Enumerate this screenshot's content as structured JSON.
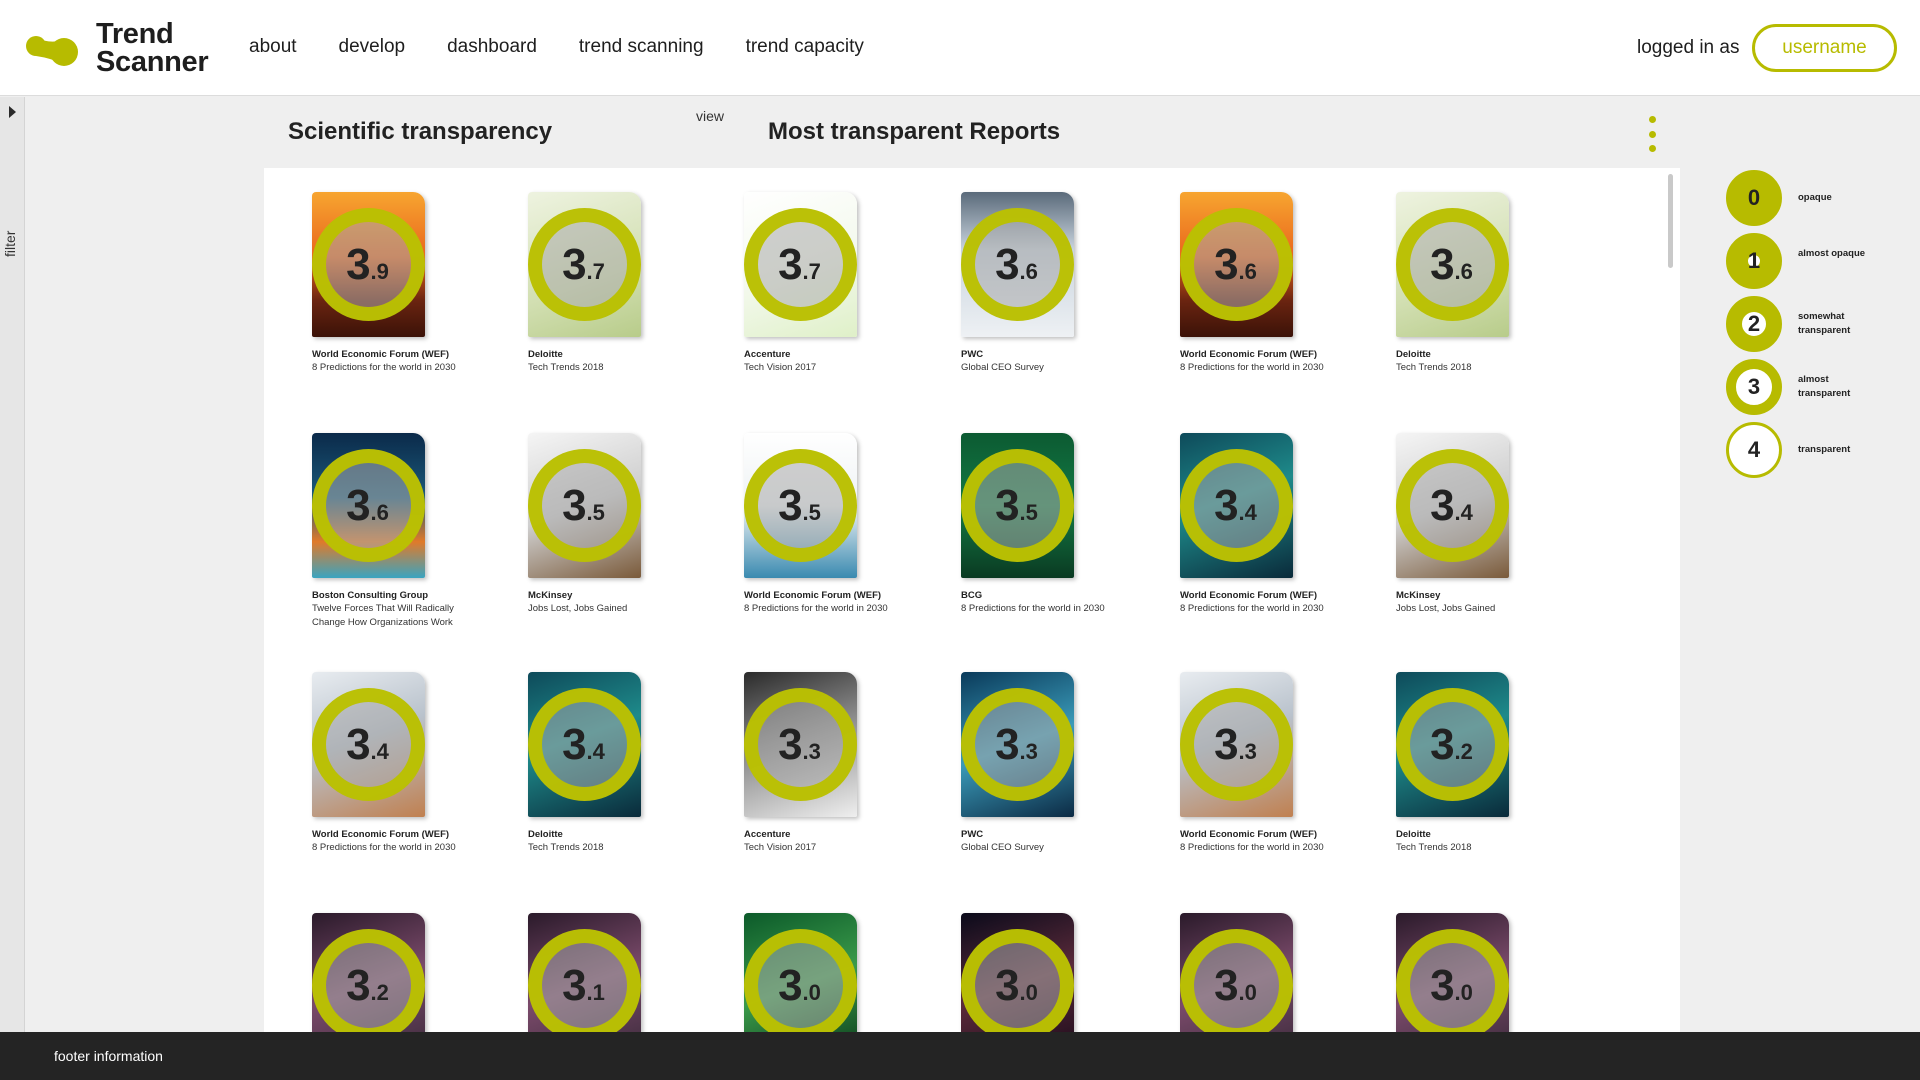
{
  "app": {
    "logo_line1": "Trend",
    "logo_line2": "Scanner",
    "accent_color": "#b7bb00"
  },
  "nav": {
    "items": [
      {
        "label": "about"
      },
      {
        "label": "develop"
      },
      {
        "label": "dashboard"
      },
      {
        "label": "trend scanning"
      },
      {
        "label": "trend capacity"
      }
    ]
  },
  "account": {
    "logged_in_label": "logged in as",
    "username": "username"
  },
  "sidebar": {
    "filter_label": "filter",
    "arrow_icon": "caret-right-icon"
  },
  "content": {
    "title_left": "Scientific transparency",
    "view_label": "view",
    "title_right": "Most transparent Reports",
    "more_icon": "more-vertical-icon"
  },
  "reports": [
    {
      "publisher": "World Economic Forum (WEF)",
      "title": "8 Predictions for the world in 2030",
      "score_int": "3",
      "score_dec": "9",
      "cover": "sunset"
    },
    {
      "publisher": "Deloitte",
      "title": "Tech Trends 2018",
      "score_int": "3",
      "score_dec": "7",
      "cover": "deloitte-green"
    },
    {
      "publisher": "Accenture",
      "title": "Tech Vision 2017",
      "score_int": "3",
      "score_dec": "7",
      "cover": "accenture"
    },
    {
      "publisher": "PWC",
      "title": "Global CEO Survey",
      "score_int": "3",
      "score_dec": "6",
      "cover": "pwc"
    },
    {
      "publisher": "World Economic Forum (WEF)",
      "title": "8 Predictions for the world in 2030",
      "score_int": "3",
      "score_dec": "6",
      "cover": "sunset"
    },
    {
      "publisher": "Deloitte",
      "title": "Tech Trends 2018",
      "score_int": "3",
      "score_dec": "6",
      "cover": "deloitte-green"
    },
    {
      "publisher": "Boston Consulting Group",
      "title": "Twelve Forces That Will Radically Change How Organizations Work",
      "score_int": "3",
      "score_dec": "6",
      "cover": "bcg-network"
    },
    {
      "publisher": "McKinsey",
      "title": "Jobs Lost, Jobs Gained",
      "score_int": "3",
      "score_dec": "5",
      "cover": "mckinsey"
    },
    {
      "publisher": "World Economic Forum (WEF)",
      "title": "8 Predictions for the world in 2030",
      "score_int": "3",
      "score_dec": "5",
      "cover": "wef-white"
    },
    {
      "publisher": "BCG",
      "title": "8 Predictions for the world in 2030",
      "score_int": "3",
      "score_dec": "5",
      "cover": "bcg-green"
    },
    {
      "publisher": "World Economic Forum (WEF)",
      "title": "8 Predictions for the world in 2030",
      "score_int": "3",
      "score_dec": "4",
      "cover": "teal-sea"
    },
    {
      "publisher": "McKinsey",
      "title": "Jobs Lost, Jobs Gained",
      "score_int": "3",
      "score_dec": "4",
      "cover": "mckinsey"
    },
    {
      "publisher": "World Economic Forum (WEF)",
      "title": "8 Predictions for the world in 2030",
      "score_int": "3",
      "score_dec": "4",
      "cover": "people"
    },
    {
      "publisher": "Deloitte",
      "title": "Tech Trends 2018",
      "score_int": "3",
      "score_dec": "4",
      "cover": "teal-sea"
    },
    {
      "publisher": "Accenture",
      "title": "Tech Vision 2017",
      "score_int": "3",
      "score_dec": "3",
      "cover": "portrait"
    },
    {
      "publisher": "PWC",
      "title": "Global CEO Survey",
      "score_int": "3",
      "score_dec": "3",
      "cover": "blue-sea"
    },
    {
      "publisher": "World Economic Forum (WEF)",
      "title": "8 Predictions for the world in 2030",
      "score_int": "3",
      "score_dec": "3",
      "cover": "people"
    },
    {
      "publisher": "Deloitte",
      "title": "Tech Trends 2018",
      "score_int": "3",
      "score_dec": "2",
      "cover": "teal-sea"
    },
    {
      "publisher": "",
      "title": "",
      "score_int": "3",
      "score_dec": "2",
      "cover": "purple-swirl"
    },
    {
      "publisher": "",
      "title": "",
      "score_int": "3",
      "score_dec": "1",
      "cover": "purple-swirl"
    },
    {
      "publisher": "",
      "title": "",
      "score_int": "3",
      "score_dec": "0",
      "cover": "green-leaf"
    },
    {
      "publisher": "",
      "title": "",
      "score_int": "3",
      "score_dec": "0",
      "cover": "dark-swirl"
    },
    {
      "publisher": "",
      "title": "",
      "score_int": "3",
      "score_dec": "0",
      "cover": "purple-swirl"
    },
    {
      "publisher": "",
      "title": "",
      "score_int": "3",
      "score_dec": "0",
      "cover": "purple-swirl"
    }
  ],
  "legend": [
    {
      "value": "0",
      "label": "opaque",
      "fill": "#b7bb00"
    },
    {
      "value": "1",
      "label": "almost opaque",
      "fill": "#b7bb00"
    },
    {
      "value": "2",
      "label": "somewhat transparent",
      "fill": "#b7bb00"
    },
    {
      "value": "3",
      "label": "almost transparent",
      "fill": "#b7bb00"
    },
    {
      "value": "4",
      "label": "transparent",
      "fill": "#ffffff"
    }
  ],
  "footer": {
    "text": "footer information"
  }
}
